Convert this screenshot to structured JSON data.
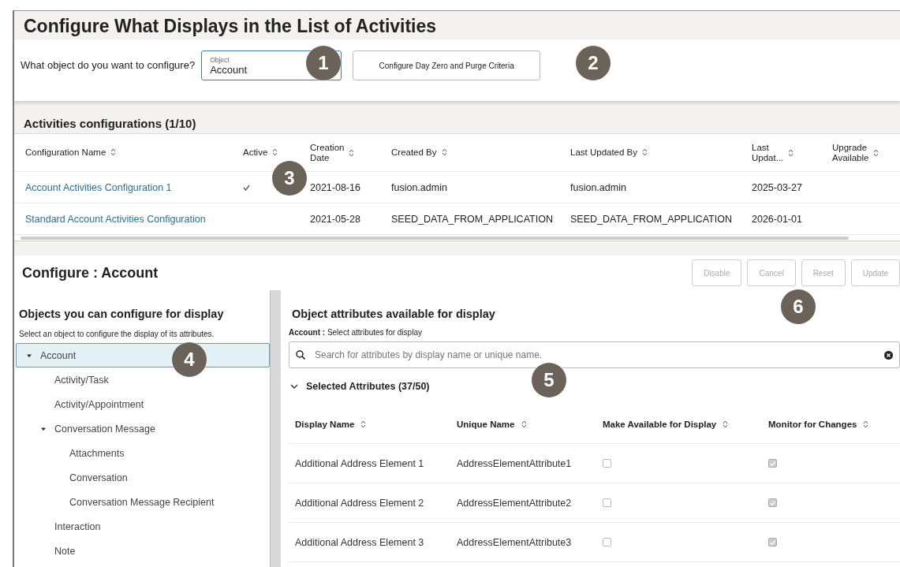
{
  "page_title": "Configure What Displays in the List of Activities",
  "object_picker": {
    "question": "What object do you want to configure?",
    "field_label": "Object",
    "value": "Account",
    "button": "Configure Day Zero and Purge Criteria"
  },
  "configurations": {
    "title": "Activities configurations (1/10)",
    "columns": [
      "Configuration Name",
      "Active",
      "Creation\nDate",
      "Created By",
      "Last Updated By",
      "Last\nUpdat...",
      "Upgrade\nAvailable"
    ],
    "rows": [
      {
        "name": "Account Activities Configuration 1",
        "active": true,
        "creation_date": "2021-08-16",
        "created_by": "fusion.admin",
        "last_updated_by": "fusion.admin",
        "last_updated": "2025-03-27"
      },
      {
        "name": "Standard Account Activities Configuration",
        "active": false,
        "creation_date": "2021-05-28",
        "created_by": "SEED_DATA_FROM_APPLICATION",
        "last_updated_by": "SEED_DATA_FROM_APPLICATION",
        "last_updated": "2026-01-01"
      }
    ]
  },
  "configure": {
    "title": "Configure : Account",
    "buttons": [
      {
        "label": "Disable",
        "disabled": true
      },
      {
        "label": "Cancel",
        "disabled": true
      },
      {
        "label": "Reset",
        "disabled": true
      },
      {
        "label": "Update",
        "disabled": true
      }
    ]
  },
  "objects_pane": {
    "title": "Objects you can configure for display",
    "hint": "Select an object to configure the display of its attributes.",
    "tree": [
      {
        "label": "Account",
        "expanded": true,
        "selected": true,
        "children": [
          {
            "label": "Activity/Task",
            "selected": false
          },
          {
            "label": "Activity/Appointment",
            "selected": false
          },
          {
            "label": "Conversation Message",
            "expanded": true,
            "selected": false,
            "children": [
              {
                "label": "Attachments",
                "selected": false
              },
              {
                "label": "Conversation",
                "selected": false
              },
              {
                "label": "Conversation Message Recipient",
                "selected": false
              }
            ]
          },
          {
            "label": "Interaction",
            "selected": false
          },
          {
            "label": "Note",
            "selected": false
          }
        ]
      }
    ]
  },
  "attributes_pane": {
    "title": "Object attributes available for display",
    "subtitle": "**Account :** Select attributes for display",
    "search": {
      "placeholder": "Search for attributes by display name or unique name."
    },
    "section": {
      "label": "Selected Attributes (37/50)",
      "expanded": true
    },
    "columns": [
      "Display Name",
      "Unique Name",
      "Make Available for Display",
      "Monitor for Changes"
    ],
    "rows": [
      {
        "display_name": "Additional Address Element 1",
        "unique_name": "AddressElementAttribute1",
        "available": false,
        "monitor": true
      },
      {
        "display_name": "Additional Address Element 2",
        "unique_name": "AddressElementAttribute2",
        "available": false,
        "monitor": true
      },
      {
        "display_name": "Additional Address Element 3",
        "unique_name": "AddressElementAttribute3",
        "available": false,
        "monitor": true
      }
    ]
  },
  "callouts": [
    "1",
    "2",
    "3",
    "4",
    "5",
    "6"
  ]
}
